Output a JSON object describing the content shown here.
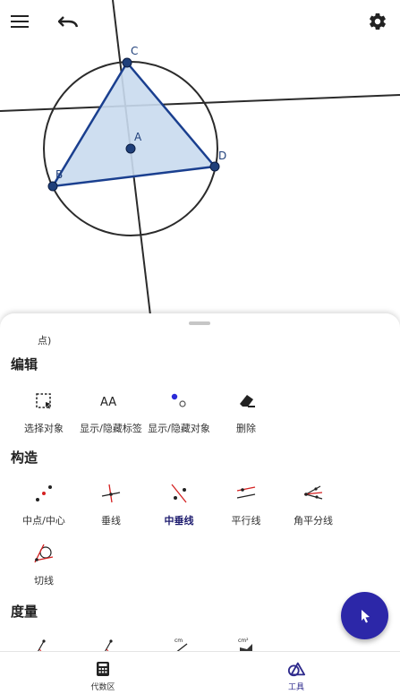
{
  "graphics": {
    "point_labels": {
      "a": "A",
      "b": "B",
      "c": "C",
      "d": "D"
    },
    "colors": {
      "polygon_stroke": "#1a3f8f",
      "polygon_fill": "#c9daee",
      "point": "#1f3f7a",
      "line": "#2b2b2b"
    }
  },
  "toolbar": {
    "menu_icon": "hamburger-menu-icon",
    "undo_icon": "undo-icon",
    "settings_icon": "gear-icon"
  },
  "panel": {
    "prev_section_tail": "点)",
    "sections": {
      "edit": {
        "title": "编辑",
        "tools": {
          "select": "选择对象",
          "show_hide_label": "显示/隐藏标签",
          "show_hide_object": "显示/隐藏对象",
          "delete": "删除"
        }
      },
      "construct": {
        "title": "构造",
        "tools": {
          "midpoint": "中点/中心",
          "perpendicular": "垂线",
          "perpendicular_bisector": "中垂线",
          "parallel": "平行线",
          "angle_bisector": "角平分线",
          "tangent": "切线"
        },
        "selected_tool": "中垂线"
      },
      "measure": {
        "title": "度量",
        "icon_text": {
          "cm": "cm",
          "cm2": "cm²"
        }
      }
    }
  },
  "bottom_nav": {
    "algebra": "代数区",
    "tools": "工具"
  },
  "fab": {
    "icon": "cursor-arrow-icon"
  },
  "accent": "#2c27a8"
}
